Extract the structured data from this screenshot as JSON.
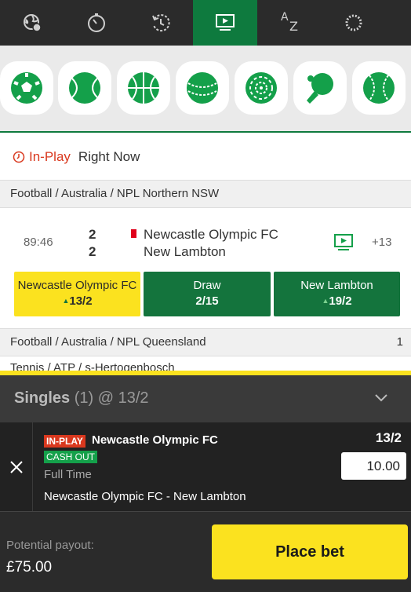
{
  "top_nav": {
    "items": [
      {
        "icon": "globe-football-icon"
      },
      {
        "icon": "stopwatch-icon"
      },
      {
        "icon": "refresh-clock-icon"
      },
      {
        "icon": "tv-icon",
        "active": true
      },
      {
        "icon": "a-z-icon",
        "a": "A",
        "z": "Z"
      },
      {
        "icon": "loading-spinner-icon"
      }
    ]
  },
  "sports": [
    "football-icon",
    "tennis-icon",
    "basketball-icon",
    "cricket-icon",
    "darts-icon",
    "table-tennis-icon",
    "tennis-ball-icon"
  ],
  "in_play": {
    "label": "In-Play",
    "subtitle": "Right Now"
  },
  "competitions": {
    "first": "Football / Australia / NPL Northern NSW",
    "second": "Football / Australia / NPL Queensland",
    "second_count": "1",
    "third_peek": "Tennis / ATP / s-Hertogenbosch"
  },
  "event": {
    "time": "89:46",
    "home_score": "2",
    "away_score": "2",
    "home_team": "Newcastle Olympic FC",
    "away_team": "New Lambton",
    "more_markets": "+13",
    "odds": {
      "home": {
        "name": "Newcastle Olympic FC",
        "price": "13/2"
      },
      "draw": {
        "name": "Draw",
        "price": "2/15"
      },
      "away": {
        "name": "New Lambton",
        "price": "19/2"
      }
    }
  },
  "betslip": {
    "title": "Singles",
    "count": "(1)",
    "at_price": "@ 13/2",
    "selection": {
      "inplay_badge": "IN-PLAY",
      "team": "Newcastle Olympic FC",
      "cashout_badge": "CASH OUT",
      "market": "Full Time",
      "event": "Newcastle Olympic FC - New Lambton",
      "price": "13/2",
      "stake": "10.00"
    },
    "payout_label": "Potential payout:",
    "payout_value": "£75.00",
    "place_bet": "Place bet"
  },
  "colors": {
    "brand_green": "#14743d",
    "yellow": "#fbe21f",
    "inplay_red": "#d9381e"
  }
}
